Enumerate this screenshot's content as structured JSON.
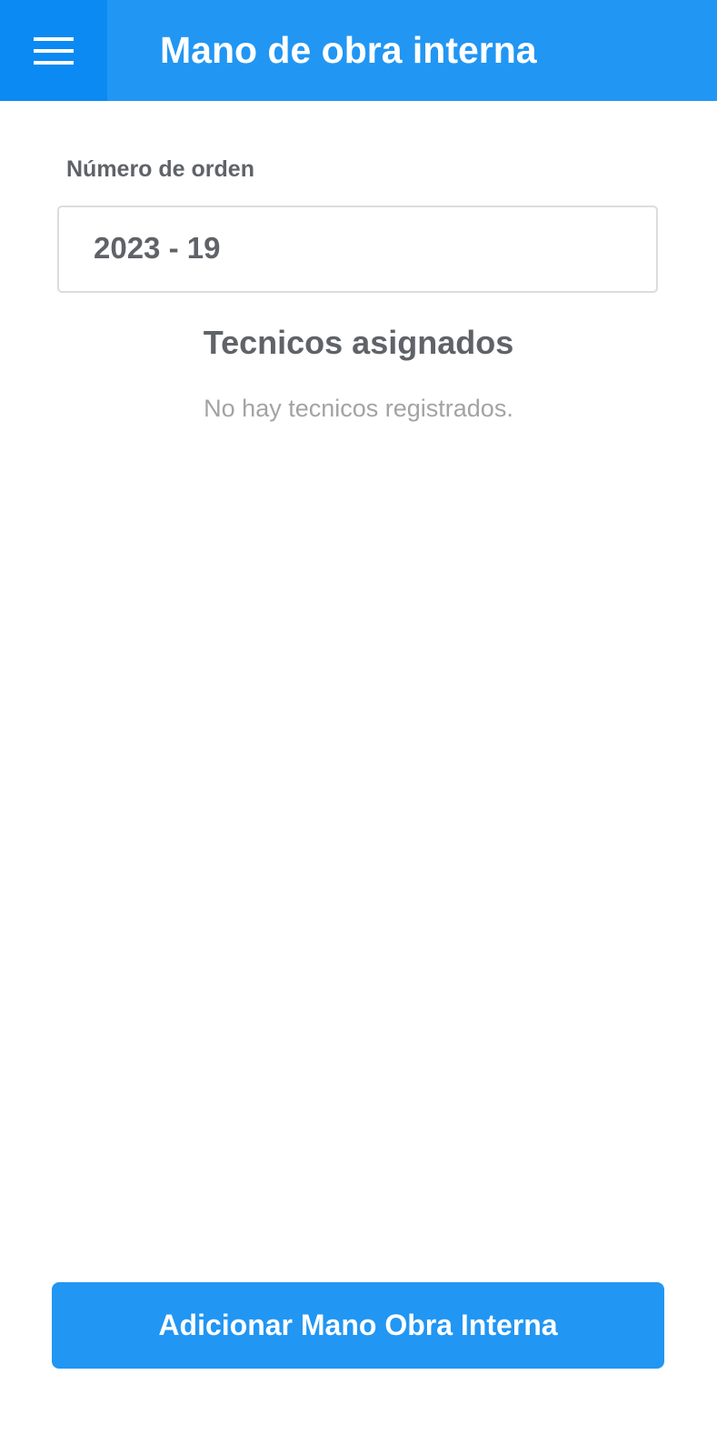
{
  "app_bar": {
    "title": "Mano de obra interna",
    "menu_icon": "menu-icon",
    "background_color": "#2196F3",
    "menu_button_color": "#0A8AF2"
  },
  "form": {
    "order_label": "Número de orden",
    "order_value": "2023 - 19"
  },
  "technicians": {
    "title": "Tecnicos asignados",
    "empty_message": "No hay tecnicos registrados."
  },
  "actions": {
    "add_button_label": "Adicionar Mano Obra Interna",
    "add_button_color": "#2196F3"
  }
}
